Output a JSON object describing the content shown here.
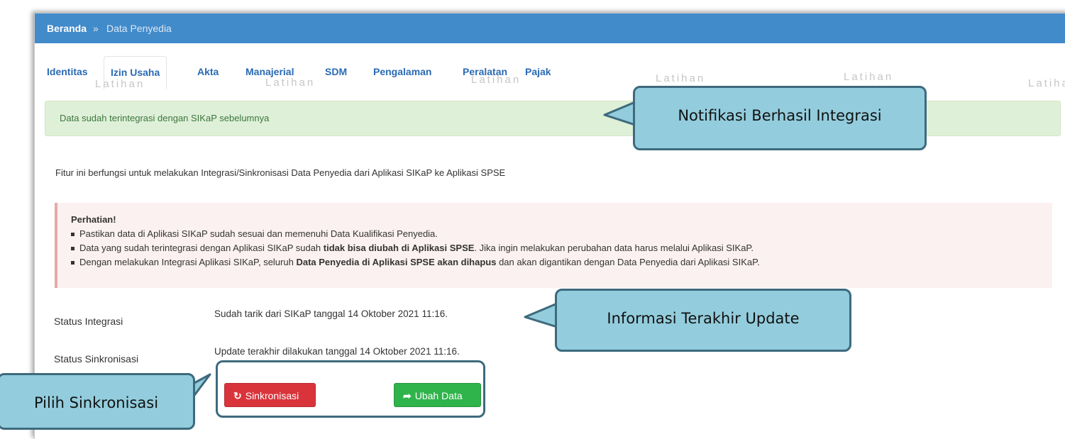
{
  "breadcrumb": {
    "home": "Beranda",
    "separator": "»",
    "current": "Data Penyedia"
  },
  "tabs": [
    {
      "label": "Identitas"
    },
    {
      "label": "Izin Usaha"
    },
    {
      "label": "Akta"
    },
    {
      "label": "Manajerial"
    },
    {
      "label": "SDM"
    },
    {
      "label": "Pengalaman"
    },
    {
      "label": "Peralatan"
    },
    {
      "label": "Pajak"
    }
  ],
  "watermark": "Latihan",
  "alert_success": "Data sudah terintegrasi dengan SIKaP sebelumnya",
  "description": "Fitur ini berfungsi untuk melakukan Integrasi/Sinkronisasi Data Penyedia dari Aplikasi SIKaP ke Aplikasi SPSE",
  "notice": {
    "title": "Perhatian!",
    "items": [
      {
        "a": "Pastikan data di Aplikasi SIKaP sudah sesuai dan memenuhi Data Kualifikasi Penyedia.",
        "b": "",
        "c": ""
      },
      {
        "a": "Data yang sudah terintegrasi dengan Aplikasi SIKaP sudah ",
        "b": "tidak bisa diubah di Aplikasi SPSE",
        "c": ". Jika ingin melakukan perubahan data harus melalui Aplikasi SIKaP."
      },
      {
        "a": "Dengan melakukan Integrasi Aplikasi SIKaP, seluruh ",
        "b": "Data Penyedia di Aplikasi SPSE akan dihapus",
        "c": " dan akan digantikan dengan Data Penyedia dari Aplikasi SIKaP."
      }
    ]
  },
  "status_integrasi": {
    "label": "Status Integrasi",
    "value": "Sudah tarik dari SIKaP tanggal 14 Oktober 2021 11:16."
  },
  "status_sinkronisasi": {
    "label": "Status Sinkronisasi",
    "value": "Update terakhir dilakukan tanggal 14 Oktober 2021 11:16."
  },
  "buttons": {
    "sync": {
      "label": "Sinkronisasi",
      "icon": "refresh-icon",
      "color": "#d9343b"
    },
    "edit": {
      "label": "Ubah Data",
      "icon": "share-arrow-icon",
      "color": "#2fb34b"
    }
  },
  "callouts": {
    "notif": "Notifikasi Berhasil Integrasi",
    "update": "Informasi Terakhir Update",
    "pilih": "Pilih Sinkronisasi"
  },
  "colors": {
    "header": "#428bca",
    "link": "#2a6ab4",
    "success_bg": "#dff0d8",
    "callout_bg": "#93cddd",
    "callout_border": "#3d6a7d"
  }
}
